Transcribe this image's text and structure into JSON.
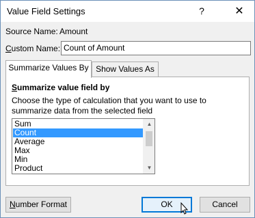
{
  "window": {
    "title": "Value Field Settings",
    "help_glyph": "?",
    "close_glyph": "✕"
  },
  "source": {
    "label": "Source Name:",
    "value": "Amount"
  },
  "custom_name": {
    "label_underline": "C",
    "label_rest": "ustom Name:",
    "value": "Count of Amount"
  },
  "tabs": [
    {
      "label": "Summarize Values By",
      "active": true
    },
    {
      "label": "Show Values As",
      "active": false
    }
  ],
  "summarize": {
    "title_underline": "S",
    "title_rest": "ummarize value field by",
    "description": "Choose the type of calculation that you want to use to summarize data from the selected field",
    "items": [
      "Sum",
      "Count",
      "Average",
      "Max",
      "Min",
      "Product"
    ],
    "selected": "Count"
  },
  "buttons": {
    "number_format_underline": "N",
    "number_format_rest": "umber Format",
    "ok": "OK",
    "cancel": "Cancel"
  },
  "colors": {
    "selection": "#3399ff",
    "default_button_border": "#0078d7"
  }
}
